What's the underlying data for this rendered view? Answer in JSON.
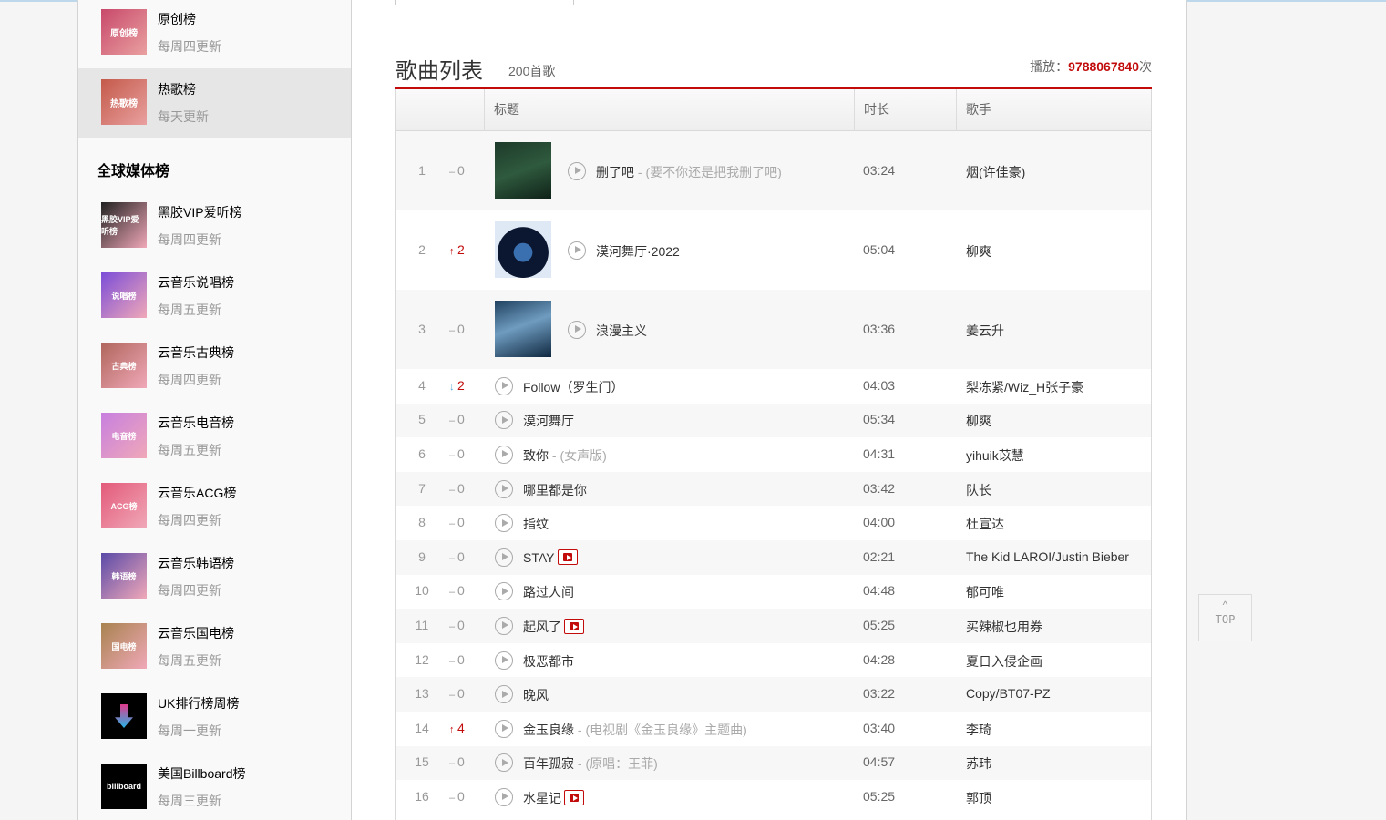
{
  "sidebar": {
    "top_items": [
      {
        "name": "原创榜",
        "freq": "每周四更新",
        "cover_text": "原创榜",
        "color": "#c8496b"
      },
      {
        "name": "热歌榜",
        "freq": "每天更新",
        "cover_text": "热歌榜",
        "color": "#c45a4a"
      }
    ],
    "section_title": "全球媒体榜",
    "media_items": [
      {
        "name": "黑胶VIP爱听榜",
        "freq": "每周四更新",
        "cover_text": "黑胶VIP爱听榜",
        "color": "#222222"
      },
      {
        "name": "云音乐说唱榜",
        "freq": "每周五更新",
        "cover_text": "说唱榜",
        "color": "#7b4dd8"
      },
      {
        "name": "云音乐古典榜",
        "freq": "每周四更新",
        "cover_text": "古典榜",
        "color": "#b0665c"
      },
      {
        "name": "云音乐电音榜",
        "freq": "每周五更新",
        "cover_text": "电音榜",
        "color": "#c77fe0"
      },
      {
        "name": "云音乐ACG榜",
        "freq": "每周四更新",
        "cover_text": "ACG榜",
        "color": "#e35a7a"
      },
      {
        "name": "云音乐韩语榜",
        "freq": "每周四更新",
        "cover_text": "韩语榜",
        "color": "#5a4aa8"
      },
      {
        "name": "云音乐国电榜",
        "freq": "每周五更新",
        "cover_text": "国电榜",
        "color": "#a8834f"
      },
      {
        "name": "UK排行榜周榜",
        "freq": "每周一更新",
        "cover_text": "",
        "color": "#000000"
      },
      {
        "name": "美国Billboard榜",
        "freq": "每周三更新",
        "cover_text": "billboard",
        "color": "#000000"
      }
    ]
  },
  "main": {
    "title": "歌曲列表",
    "count": "200首歌",
    "plays_label": "播放：",
    "plays_value": "9788067840",
    "plays_unit": "次",
    "columns": [
      "标题",
      "时长",
      "歌手"
    ],
    "songs": [
      {
        "num": "1",
        "trend": "new",
        "change": "0",
        "title": "删了吧",
        "alias": "(要不你还是把我删了吧)",
        "mv": false,
        "duration": "03:24",
        "artist": "烟(许佳豪)"
      },
      {
        "num": "2",
        "trend": "up",
        "change": "2",
        "title": "漠河舞厅·2022",
        "alias": "",
        "mv": false,
        "duration": "05:04",
        "artist": "柳爽"
      },
      {
        "num": "3",
        "trend": "new",
        "change": "0",
        "title": "浪漫主义",
        "alias": "",
        "mv": false,
        "duration": "03:36",
        "artist": "姜云升"
      },
      {
        "num": "4",
        "trend": "down",
        "change": "2",
        "title": "Follow（罗生门）",
        "alias": "",
        "mv": false,
        "duration": "04:03",
        "artist": "梨冻紧/Wiz_H张子豪"
      },
      {
        "num": "5",
        "trend": "new",
        "change": "0",
        "title": "漠河舞厅",
        "alias": "",
        "mv": false,
        "duration": "05:34",
        "artist": "柳爽"
      },
      {
        "num": "6",
        "trend": "new",
        "change": "0",
        "title": "致你",
        "alias": "(女声版)",
        "mv": false,
        "duration": "04:31",
        "artist": "yihuik苡慧"
      },
      {
        "num": "7",
        "trend": "new",
        "change": "0",
        "title": "哪里都是你",
        "alias": "",
        "mv": false,
        "duration": "03:42",
        "artist": "队长"
      },
      {
        "num": "8",
        "trend": "new",
        "change": "0",
        "title": "指纹",
        "alias": "",
        "mv": false,
        "duration": "04:00",
        "artist": "杜宣达"
      },
      {
        "num": "9",
        "trend": "new",
        "change": "0",
        "title": "STAY",
        "alias": "",
        "mv": true,
        "duration": "02:21",
        "artist": "The Kid LAROI/Justin Bieber"
      },
      {
        "num": "10",
        "trend": "new",
        "change": "0",
        "title": "路过人间",
        "alias": "",
        "mv": false,
        "duration": "04:48",
        "artist": "郁可唯"
      },
      {
        "num": "11",
        "trend": "new",
        "change": "0",
        "title": "起风了",
        "alias": "",
        "mv": true,
        "duration": "05:25",
        "artist": "买辣椒也用券"
      },
      {
        "num": "12",
        "trend": "new",
        "change": "0",
        "title": "极恶都市",
        "alias": "",
        "mv": false,
        "duration": "04:28",
        "artist": "夏日入侵企画"
      },
      {
        "num": "13",
        "trend": "new",
        "change": "0",
        "title": "晚风",
        "alias": "",
        "mv": false,
        "duration": "03:22",
        "artist": "Copy/BT07-PZ"
      },
      {
        "num": "14",
        "trend": "up",
        "change": "4",
        "title": "金玉良缘",
        "alias": "(电视剧《金玉良缘》主题曲)",
        "mv": false,
        "duration": "03:40",
        "artist": "李琦"
      },
      {
        "num": "15",
        "trend": "new",
        "change": "0",
        "title": "百年孤寂",
        "alias": "(原唱：王菲)",
        "mv": false,
        "duration": "04:57",
        "artist": "苏玮"
      },
      {
        "num": "16",
        "trend": "new",
        "change": "0",
        "title": "水星记",
        "alias": "",
        "mv": true,
        "duration": "05:25",
        "artist": "郭顶"
      }
    ]
  },
  "back_to_top": {
    "label": "TOP",
    "icon": "chevron-up-icon"
  },
  "colors": {
    "accent": "#c20c0c",
    "trend_down": "#59a7d9"
  }
}
